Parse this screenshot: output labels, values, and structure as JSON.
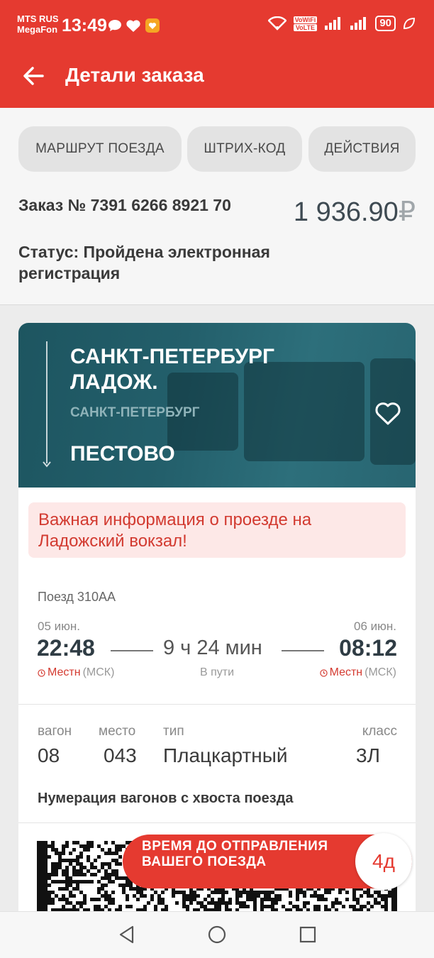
{
  "status_bar": {
    "carrier_1": "MTS RUS",
    "carrier_2": "MegaFon",
    "time": "13:49",
    "vowifi": "VoWiFi",
    "volte": "VoLTE",
    "battery": "90",
    "icons": [
      "chat-bubble-icon",
      "heart-icon",
      "gift-app-icon",
      "wifi-icon",
      "signal-icon",
      "leaf-icon"
    ]
  },
  "app_bar": {
    "title": "Детали заказа",
    "back_icon": "arrow-left-icon"
  },
  "chips": [
    "МАРШРУТ ПОЕЗДА",
    "ШТРИХ-КОД",
    "ДЕЙСТВИЯ"
  ],
  "order": {
    "number": "Заказ № 7391 6266 8921 70",
    "status": "Статус: Пройдена электронная регистрация",
    "price": "1 936.90",
    "currency": "₽"
  },
  "route": {
    "from_station": "САНКТ-ПЕТЕРБУРГ ЛАДОЖ.",
    "from_city": "САНКТ-ПЕТЕРБУРГ",
    "to_station": "ПЕСТОВО"
  },
  "alert": "Важная информация о проезде на Ладожский вокзал!",
  "trip": {
    "train": "Поезд 310АА",
    "departure": {
      "date": "05 июн.",
      "time": "22:48",
      "tz_label": "Местн",
      "tz_note": "(МСК)"
    },
    "arrival": {
      "date": "06 июн.",
      "time": "08:12",
      "tz_label": "Местн",
      "tz_note": "(МСК)"
    },
    "duration": "9 ч 24 мин",
    "duration_label": "В пути"
  },
  "seat": {
    "headers": [
      "вагон",
      "место",
      "тип",
      "класс"
    ],
    "values": [
      "08",
      "043",
      "Плацкартный",
      "3Л"
    ]
  },
  "numbering_note": "Нумерация вагонов с хвоста поезда",
  "timer": {
    "text": "ВРЕМЯ ДО ОТПРАВЛЕНИЯ ВАШЕГО ПОЕЗДА",
    "value": "4д"
  },
  "colors": {
    "brand_red": "#e53a30",
    "hero_teal": "#235f6b",
    "alert_bg": "#fde8e7"
  }
}
